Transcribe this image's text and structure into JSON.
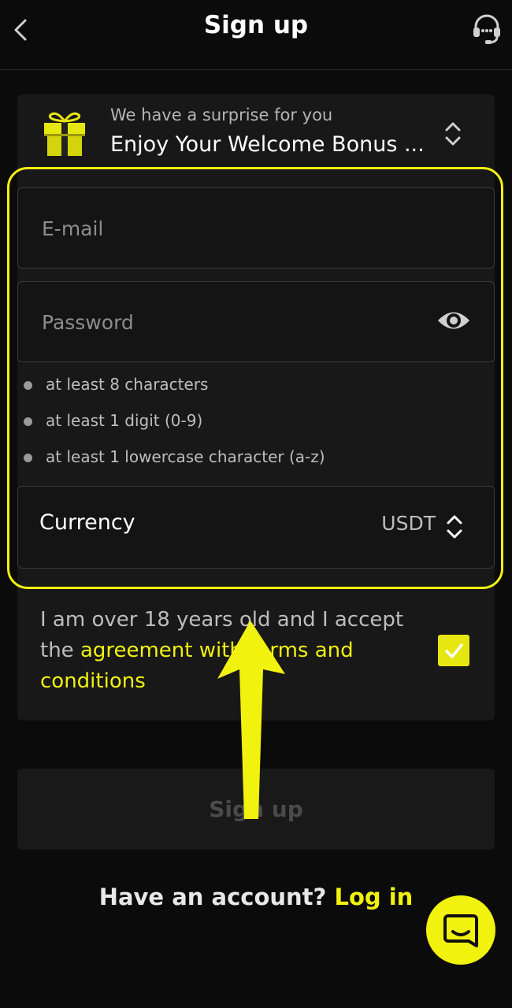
{
  "header": {
    "title": "Sign up"
  },
  "bonus": {
    "subtitle": "We have a surprise for you",
    "title": "Enjoy Your Welcome Bonus ..."
  },
  "form": {
    "email_placeholder": "E-mail",
    "password_placeholder": "Password",
    "rules": [
      "at least 8 characters",
      "at least 1 digit (0-9)",
      "at least 1 lowercase character (a-z)"
    ],
    "currency_label": "Currency",
    "currency_value": "USDT"
  },
  "terms": {
    "text_before": "I am over 18 years old and I accept the ",
    "link_text": "agreement with terms and conditions",
    "checked": true
  },
  "signup_button": "Sign up",
  "footer": {
    "question": "Have an account?",
    "login_link": "Log in"
  },
  "colors": {
    "accent": "#f2f20f",
    "background": "#0b0b0b",
    "card": "#181818"
  },
  "icons": [
    "back-arrow-icon",
    "headset-support-icon",
    "gift-icon",
    "sort-icon",
    "eye-icon",
    "check-icon",
    "chat-icon"
  ]
}
